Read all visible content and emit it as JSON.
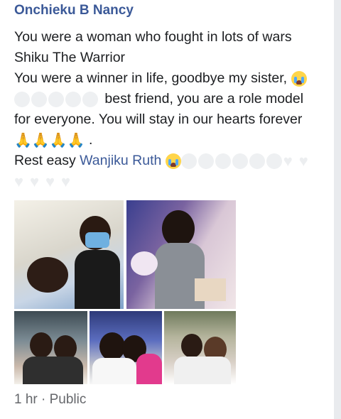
{
  "post": {
    "author": "Onchieku B Nancy",
    "lines": [
      "You were a  woman who fought in lots of wars",
      "Shiku The Warrior",
      "You were a  winner in life, goodbye my sister,"
    ],
    "line4": "best friend,  you are a role model",
    "line5": "for everyone. You will stay in our hearts forever",
    "line6_tail": ".",
    "rest_prefix": "Rest easy",
    "tagged_name": "Wanjiku Ruth",
    "meta": "1 hr · Public"
  },
  "icons": {
    "crying": "loudly-crying-face-icon",
    "pray": "folded-hands-icon",
    "heart": "heart-icon",
    "public": "globe-icon"
  },
  "colors": {
    "author": "#3b5998",
    "link": "#3b5998",
    "text": "#1c1e21",
    "meta": "#65676b"
  }
}
